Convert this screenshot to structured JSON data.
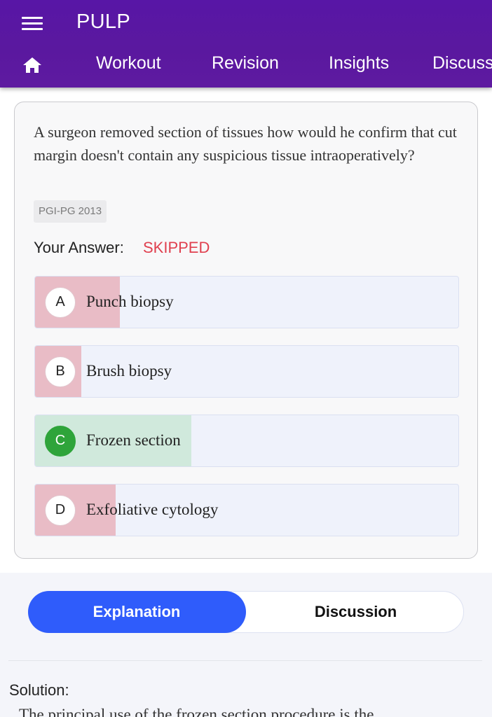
{
  "app": {
    "title": "PULP",
    "nav_tabs": [
      "Workout",
      "Revision",
      "Insights",
      "Discuss"
    ]
  },
  "question": {
    "text": "A surgeon removed section of tissues how would he confirm that cut margin doesn't contain any suspicious tissue intraoperatively?",
    "tag": "PGI-PG 2013",
    "your_answer_label": "Your Answer:",
    "your_answer_value": "SKIPPED",
    "options": [
      {
        "letter": "A",
        "label": "Punch biopsy",
        "response_share": 0.2,
        "status": "incorrect"
      },
      {
        "letter": "B",
        "label": "Brush biopsy",
        "response_share": 0.11,
        "status": "incorrect"
      },
      {
        "letter": "C",
        "label": "Frozen section",
        "response_share": 0.37,
        "status": "correct"
      },
      {
        "letter": "D",
        "label": "Exfoliative cytology",
        "response_share": 0.19,
        "status": "incorrect"
      }
    ]
  },
  "tabs": {
    "explanation": "Explanation",
    "discussion": "Discussion",
    "active": "explanation"
  },
  "solution": {
    "title": "Solution:",
    "text": "The principal use of the frozen section procedure is the"
  },
  "colors": {
    "appbar": "#5a189f",
    "skipped": "#e0404f",
    "correct": "#2ea43a",
    "incorrect_fill": "#e9bcc6",
    "correct_fill": "#d0e9dc",
    "active_tab": "#2f5cfb"
  }
}
